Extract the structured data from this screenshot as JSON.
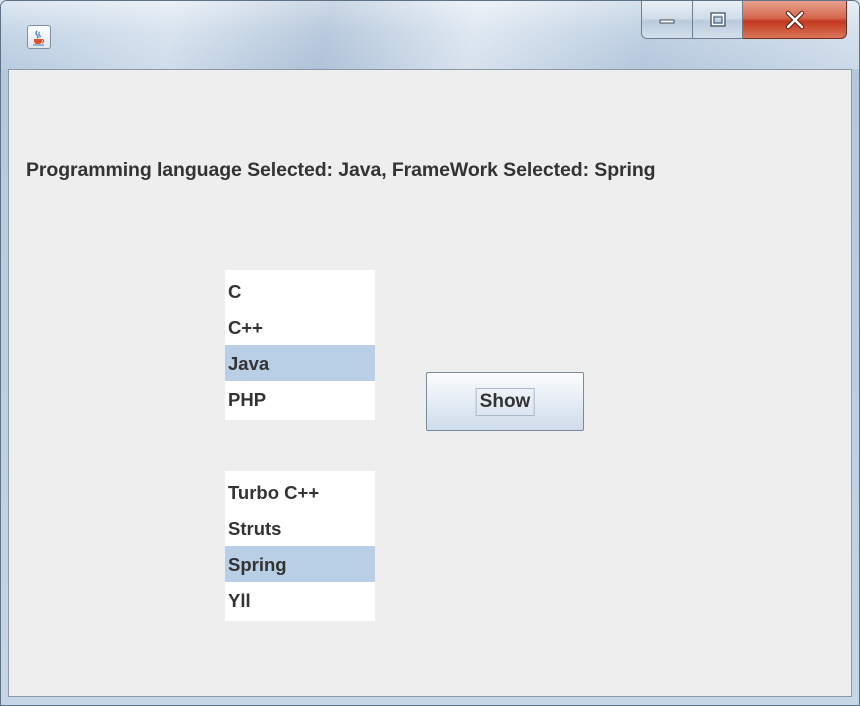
{
  "window": {
    "title": "",
    "app_icon": "java-coffee-cup-icon",
    "controls": {
      "minimize_icon": "minimize-icon",
      "maximize_icon": "maximize-icon",
      "close_icon": "close-icon"
    }
  },
  "status": {
    "text": "Programming language Selected: Java, FrameWork Selected: Spring"
  },
  "language_list": {
    "items": [
      "C",
      "C++",
      "Java",
      "PHP"
    ],
    "selected": "Java"
  },
  "framework_list": {
    "items": [
      "Turbo C++",
      "Struts",
      "Spring",
      "Yll"
    ],
    "selected": "Spring"
  },
  "show_button": {
    "label": "Show"
  },
  "colors": {
    "selection": "#b8cfe5",
    "panel_background": "#eeeeee",
    "close_button": "#c4381e"
  }
}
